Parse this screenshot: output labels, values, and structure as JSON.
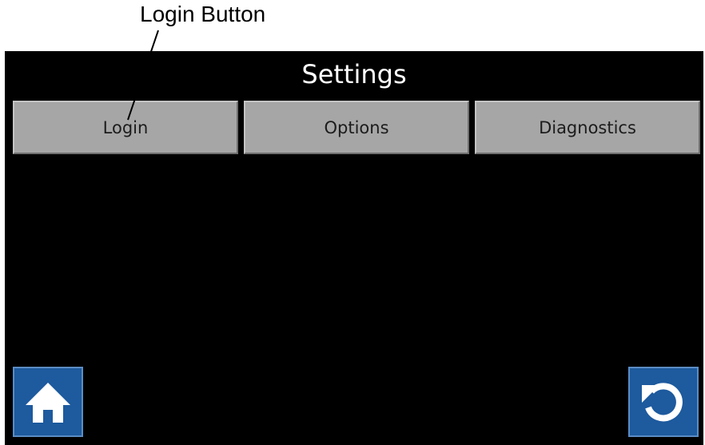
{
  "callout": {
    "label": "Login Button"
  },
  "screen": {
    "title": "Settings",
    "tabs": [
      {
        "label": "Login"
      },
      {
        "label": "Options"
      },
      {
        "label": "Diagnostics"
      }
    ],
    "home_icon": "home-icon",
    "back_icon": "undo-arrow-icon"
  },
  "colors": {
    "screen_background": "#000000",
    "tab_background": "#a6a6a6",
    "icon_button_background": "#1d5a9e",
    "title_text": "#ffffff"
  }
}
